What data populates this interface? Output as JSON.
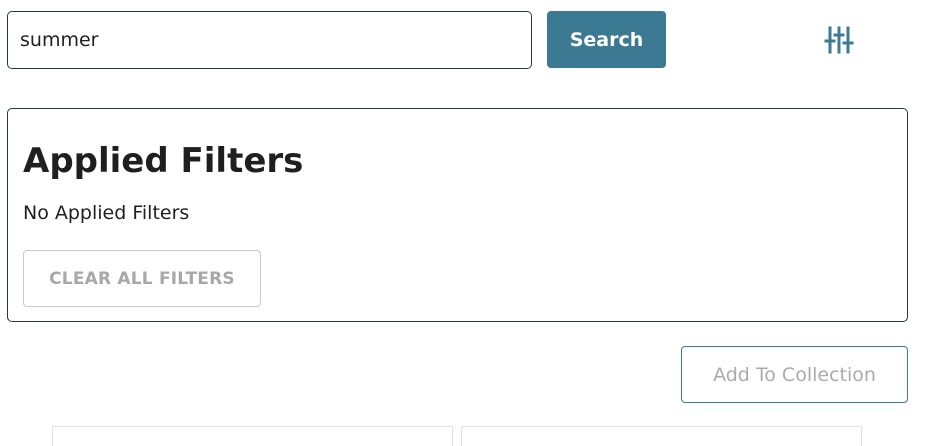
{
  "search": {
    "value": "summer",
    "button_label": "Search"
  },
  "filter_toggle": {
    "icon": "sliders-icon",
    "color": "#3c7a93"
  },
  "applied_filters": {
    "title": "Applied Filters",
    "empty_text": "No Applied Filters",
    "clear_label": "CLEAR ALL FILTERS"
  },
  "actions": {
    "add_to_collection_label": "Add To Collection"
  },
  "colors": {
    "accent": "#3c7a93",
    "border_dark": "#243746",
    "disabled_text": "#a8a8a8"
  }
}
